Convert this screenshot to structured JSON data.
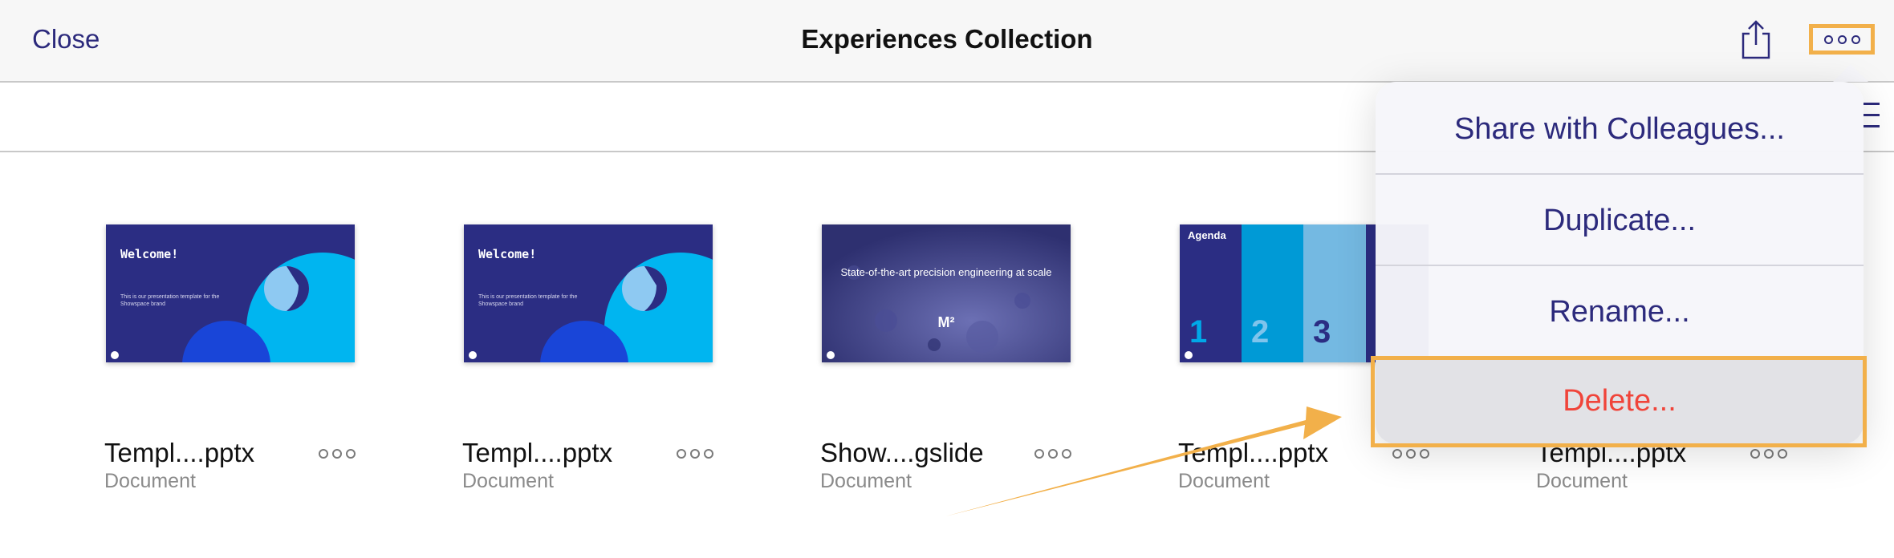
{
  "nav": {
    "close_label": "Close",
    "title": "Experiences Collection",
    "share_icon": "share-icon",
    "more_icon": "more-icon"
  },
  "toolbar": {
    "view_icon": "list-view-icon"
  },
  "documents": [
    {
      "name": "Templ....pptx",
      "type": "Document",
      "thumb": {
        "title": "Welcome!",
        "subtitle": "This is our presentation template for the Showspace brand"
      }
    },
    {
      "name": "Templ....pptx",
      "type": "Document",
      "thumb": {
        "title": "Welcome!",
        "subtitle": "This is our presentation template for the Showspace brand"
      }
    },
    {
      "name": "Show....gslide",
      "type": "Document",
      "thumb": {
        "title": "State-of-the-art precision engineering at scale",
        "mark": "M²"
      }
    },
    {
      "name": "Templ....pptx",
      "type": "Document",
      "thumb": {
        "title": "Agenda",
        "numbers": [
          "1",
          "2",
          "3"
        ]
      }
    },
    {
      "name": "Templ....pptx",
      "type": "Document"
    }
  ],
  "menu": {
    "items": [
      "Share with Colleagues...",
      "Duplicate...",
      "Rename...",
      "Delete..."
    ]
  },
  "colors": {
    "accent": "#2c2a7c",
    "delete": "#f0443a",
    "highlight": "#f2b04a",
    "slide_bg": "#2b2d83"
  }
}
